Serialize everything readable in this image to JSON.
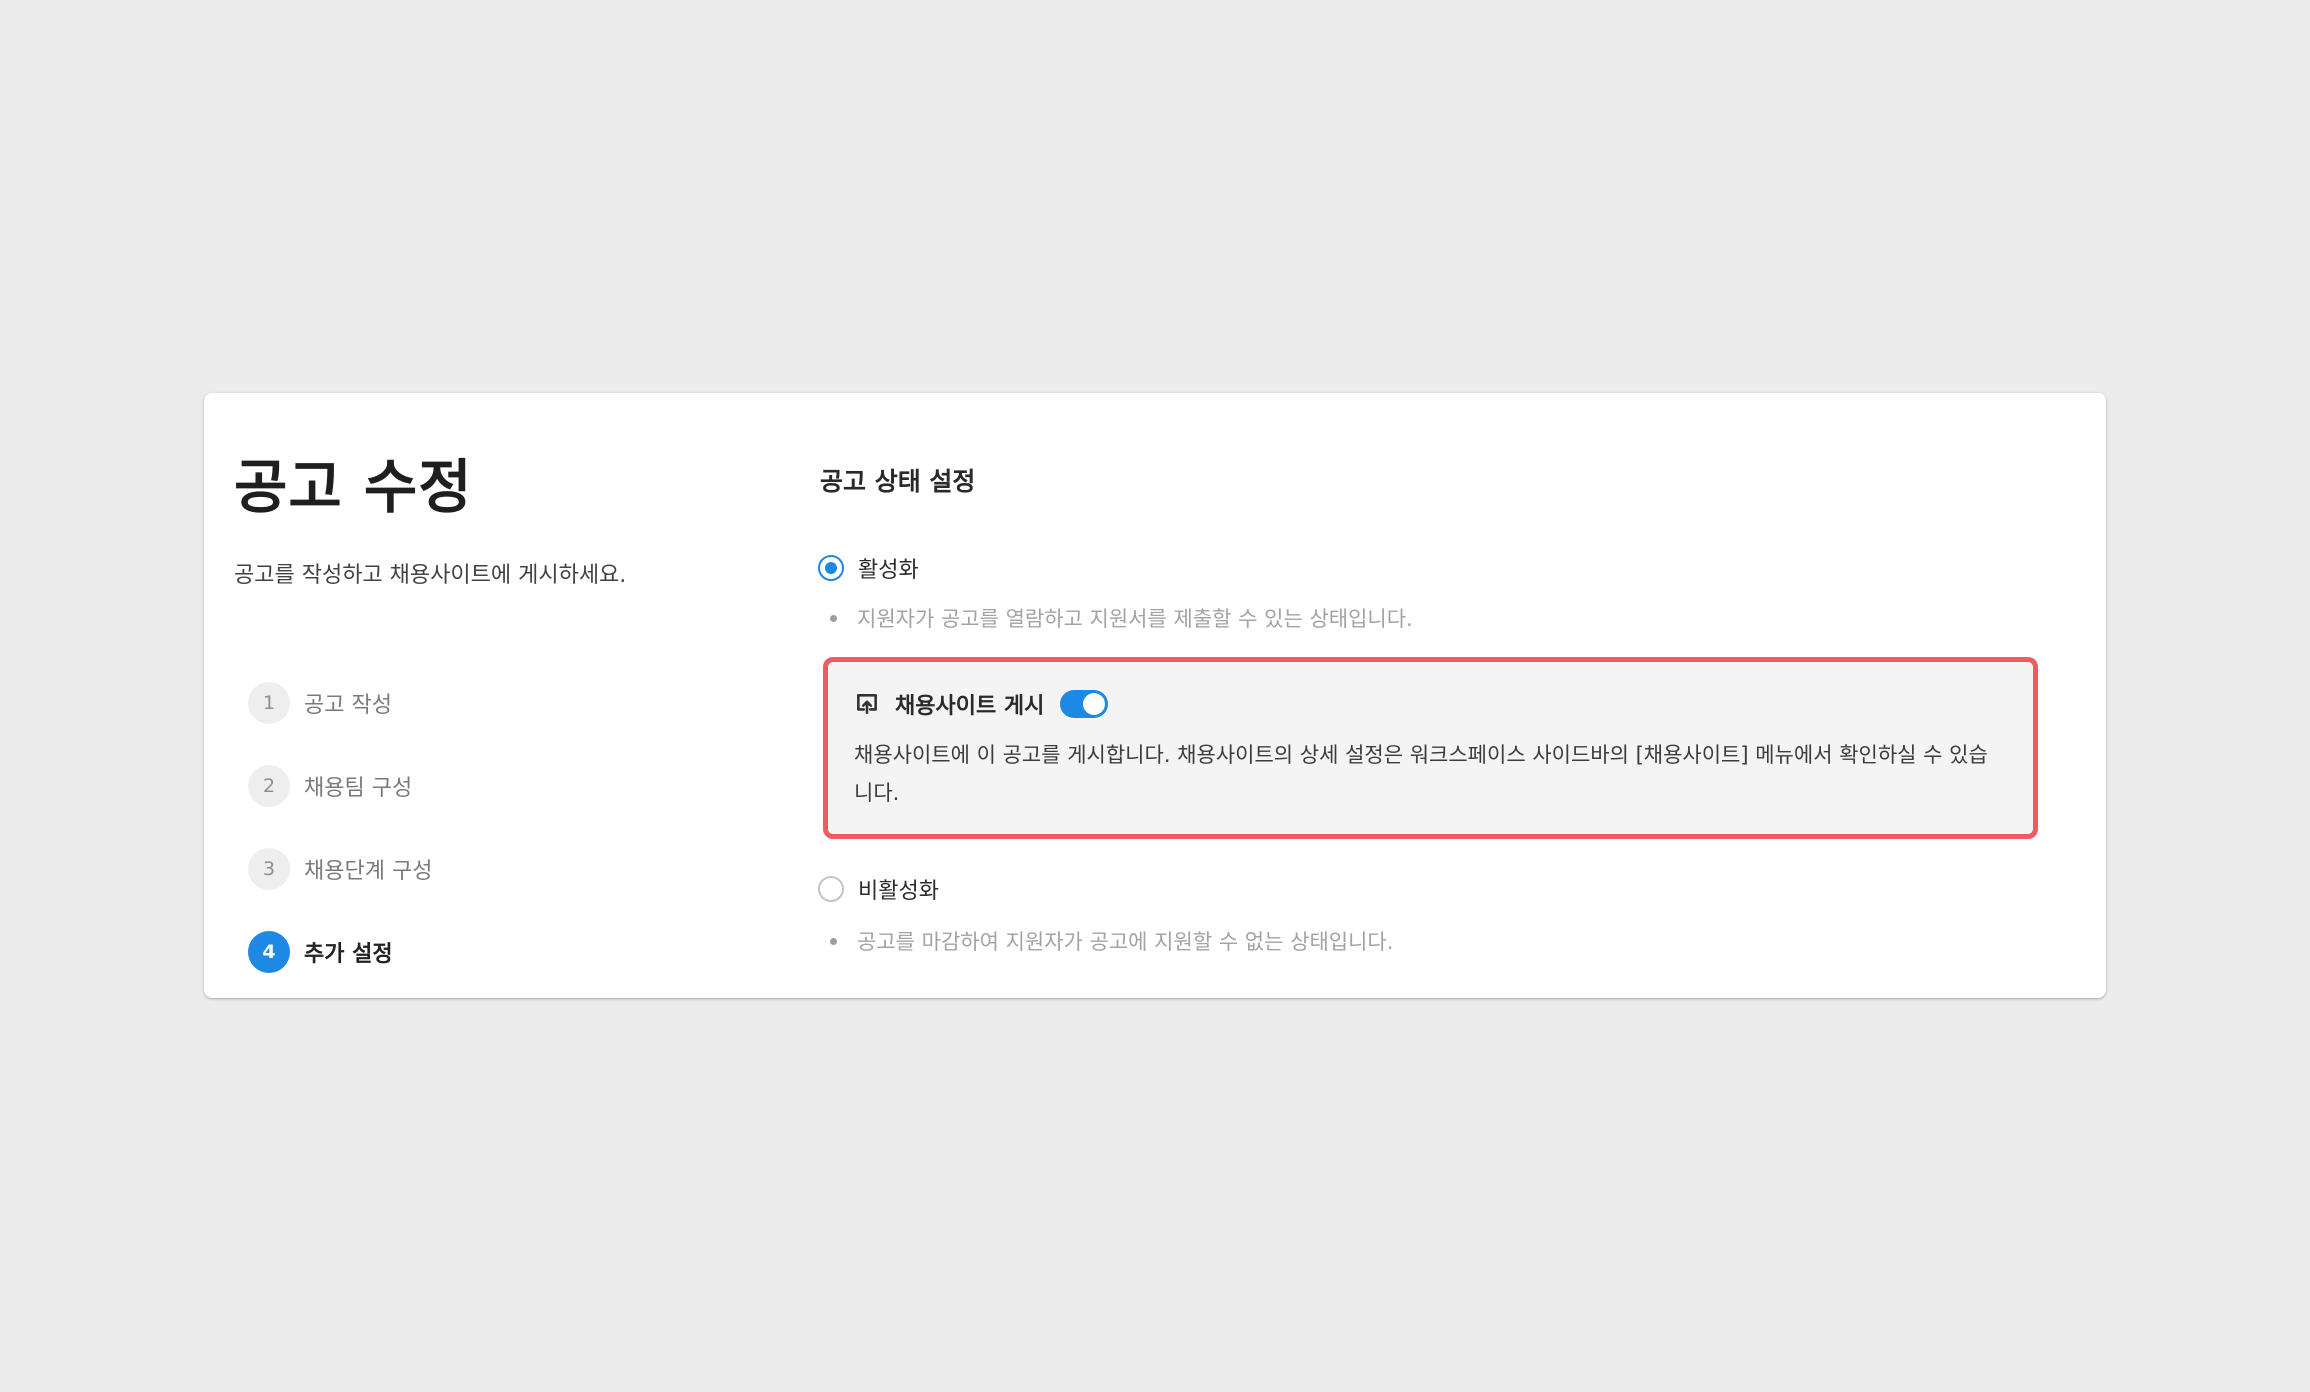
{
  "page": {
    "title": "공고 수정",
    "subtitle": "공고를 작성하고 채용사이트에 게시하세요."
  },
  "steps": [
    {
      "number": "1",
      "label": "공고 작성",
      "active": false
    },
    {
      "number": "2",
      "label": "채용팀 구성",
      "active": false
    },
    {
      "number": "3",
      "label": "채용단계 구성",
      "active": false
    },
    {
      "number": "4",
      "label": "추가 설정",
      "active": true
    }
  ],
  "status": {
    "section_title": "공고 상태 설정",
    "active": {
      "label": "활성화",
      "checked": true,
      "description": "지원자가 공고를 열람하고 지원서를 제출할 수 있는 상태입니다."
    },
    "publish": {
      "icon": "publish-site-icon",
      "title": "채용사이트 게시",
      "enabled": true,
      "description": "채용사이트에 이 공고를 게시합니다. 채용사이트의 상세 설정은 워크스페이스 사이드바의 [채용사이트] 메뉴에서 확인하실 수 있습니다."
    },
    "inactive": {
      "label": "비활성화",
      "checked": false,
      "description": "공고를 마감하여 지원자가 공고에 지원할 수 없는 상태입니다."
    }
  },
  "colors": {
    "background": "#ececec",
    "accent": "#1e88e5",
    "highlight_border": "#ee5b63"
  }
}
